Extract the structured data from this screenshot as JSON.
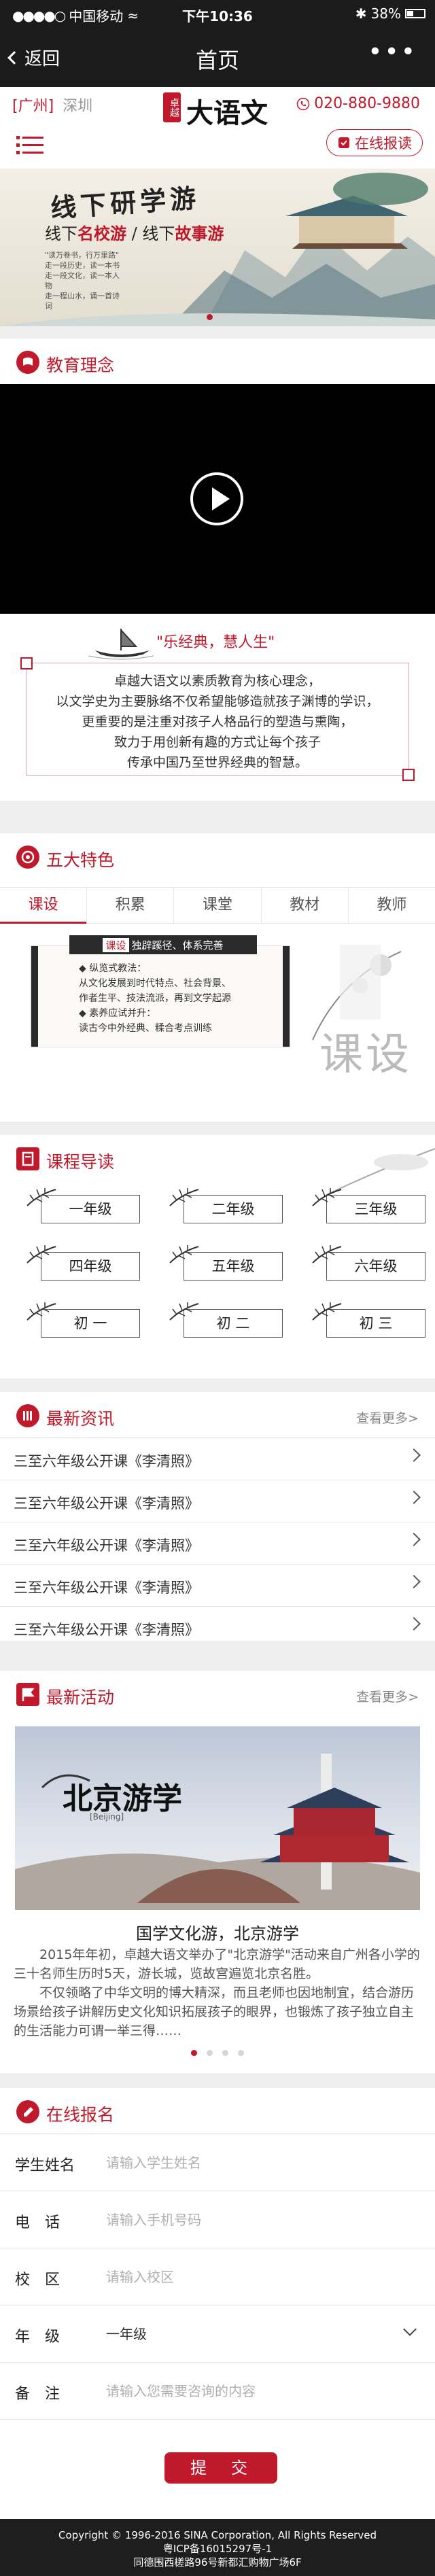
{
  "status_bar": {
    "carrier": "中国移动",
    "time": "下午10:36",
    "battery": "38%"
  },
  "nav": {
    "back": "返回",
    "title": "首页"
  },
  "header": {
    "city_current": "[广州]",
    "city_other": "深圳",
    "logo_text": "大语文",
    "logo_seal": "卓越",
    "phone": "020-880-9880",
    "signup_button": "在线报读"
  },
  "banner": {
    "title": "线下研学游",
    "line_prefix": "线下",
    "line_hl1": "名校游",
    "line_mid": " / 线下",
    "line_hl2": "故事游",
    "small_lines": [
      "\"读万卷书，行万里路\"",
      "走一段历史，读一本书",
      "走一段文化，读一本人物",
      "走一程山水，诵一首诗词"
    ],
    "dots": 4,
    "active_dot": 1
  },
  "sections": {
    "philosophy": "教育理念",
    "features": "五大特色",
    "courses": "课程导读",
    "news": "最新资讯",
    "activities": "最新活动",
    "signup": "在线报名",
    "more": "查看更多>"
  },
  "philosophy": {
    "slogan": "\"乐经典，慧人生\"",
    "lines": [
      "卓越大语文以素质教育为核心理念，",
      "以文学史为主要脉络不仅希望能够造就孩子渊博的学识，",
      "更重要的是注重对孩子人格品行的塑造与熏陶，",
      "致力于用创新有趣的方式让每个孩子",
      "传承中国乃至世界经典的智慧。"
    ]
  },
  "features": {
    "tabs": [
      "课设",
      "积累",
      "课堂",
      "教材",
      "教师"
    ],
    "active_tab": 0,
    "scroll_tag_hl": "课设",
    "scroll_tag_rest": "独辟蹊径、体系完善",
    "scroll_lines": [
      "◆ 纵览式教法：",
      "从文化发展到时代特点、社会背景、",
      "作者生平、技法流派，再到文学起源",
      "◆ 素养应试并升：",
      "读古今中外经典、糅合考点训练"
    ],
    "big_word": "课设"
  },
  "courses": {
    "grades": [
      "一年级",
      "二年级",
      "三年级",
      "四年级",
      "五年级",
      "六年级",
      "初 一",
      "初 二",
      "初 三"
    ]
  },
  "news": {
    "items": [
      "三至六年级公开课《李清照》",
      "三至六年级公开课《李清照》",
      "三至六年级公开课《李清照》",
      "三至六年级公开课《李清照》",
      "三至六年级公开课《李清照》"
    ]
  },
  "activities": {
    "image_title": "北京游学",
    "image_sub": "[Beijing]",
    "title": "国学文化游，北京游学",
    "paragraphs": [
      "2015年年初，卓越大语文举办了\"北京游学\"活动来自广州各小学的三十名师生历时5天，游长城，览故宫遍览北京名胜。",
      "不仅领略了中华文明的博大精深，而且老师也因地制宜，结合游历场景给孩子讲解历史文化知识拓展孩子的眼界，也锻炼了孩子独立自主的生活能力可谓一举三得……"
    ],
    "dots": 4,
    "active_dot": 0
  },
  "form": {
    "fields": [
      {
        "label": "学生姓名",
        "placeholder": "请输入学生姓名"
      },
      {
        "label": "电　话",
        "placeholder": "请输入手机号码"
      },
      {
        "label": "校　区",
        "placeholder": "请输入校区"
      },
      {
        "label": "年　级",
        "value": "一年级"
      },
      {
        "label": "备　注",
        "placeholder": "请输入您需要咨询的内容"
      }
    ],
    "submit": "提　交"
  },
  "footer": {
    "lines": [
      "Copyright © 1996-2016 SINA Corporation, All Rights Reserved",
      "粤ICP备16015297号-1",
      "同德围西槎路96号新都汇购物广场6F"
    ]
  },
  "colors": {
    "brand": "#c0192c",
    "dark": "#1b1b1b"
  }
}
